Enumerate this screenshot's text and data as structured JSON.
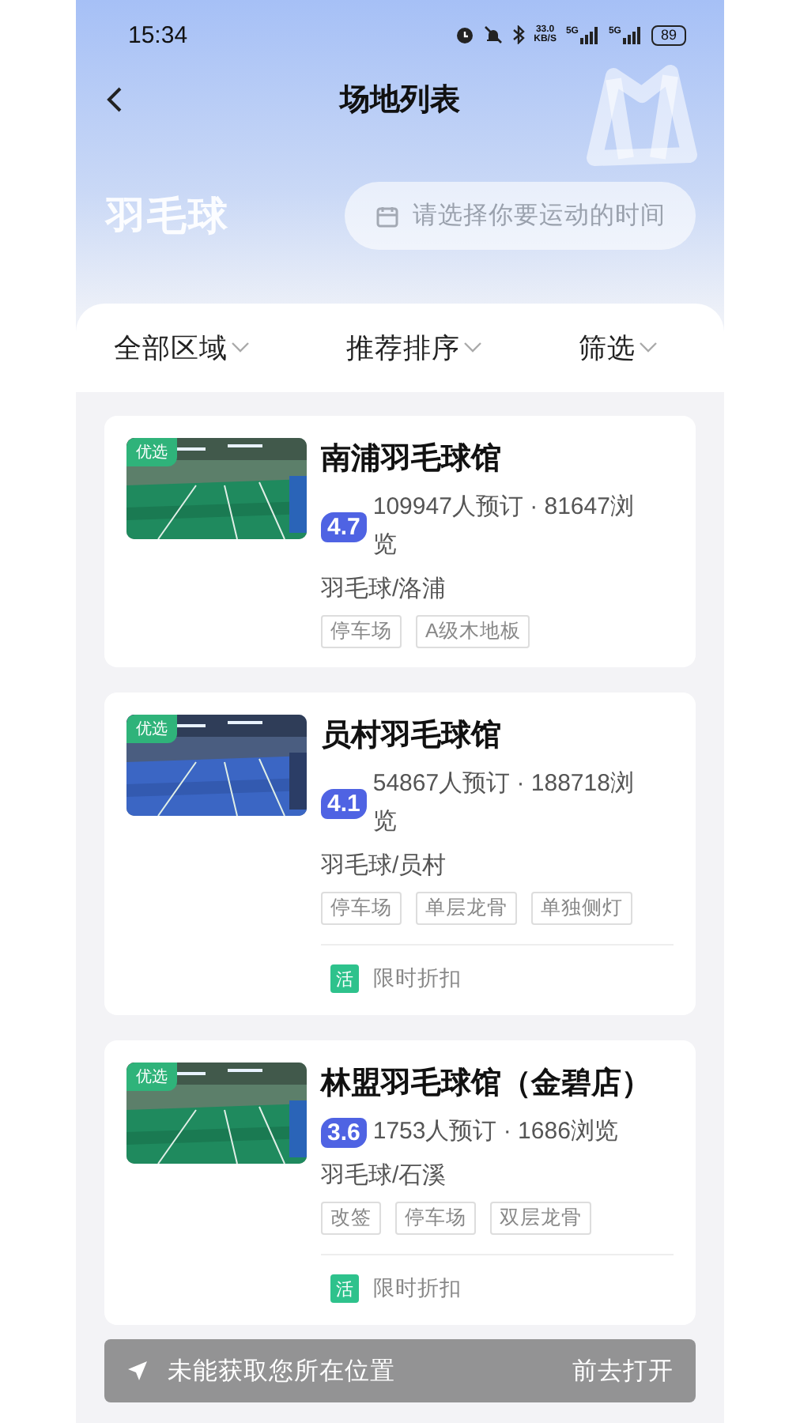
{
  "status_bar": {
    "time": "15:34",
    "speed": "33.0",
    "speed_unit": "KB/S",
    "networks": [
      "5G",
      "5G"
    ],
    "battery": "89"
  },
  "nav": {
    "title": "场地列表"
  },
  "hero": {
    "sport": "羽毛球",
    "date_field": {
      "placeholder": "请选择你要运动的时间"
    }
  },
  "filters": [
    {
      "label": "全部区域"
    },
    {
      "label": "推荐排序"
    },
    {
      "label": "筛选"
    }
  ],
  "venues": [
    {
      "badge": "优选",
      "image": {
        "kind": "picture"
      },
      "name": "南浦羽毛球馆",
      "rating": "4.7",
      "stats": "109947人预订 · 81647浏览",
      "category": "羽毛球/洛浦",
      "tags": [
        "停车场",
        "A级木地板"
      ]
    },
    {
      "badge": "优选",
      "image": {
        "kind": "picture"
      },
      "name": "员村羽毛球馆",
      "rating": "4.1",
      "stats": "54867人预订 · 188718浏览",
      "category": "羽毛球/员村",
      "tags": [
        "停车场",
        "单层龙骨",
        "单独侧灯"
      ],
      "promotions": [
        {
          "tag": "活",
          "text": "限时折扣"
        }
      ]
    },
    {
      "badge": "优选",
      "image": {
        "kind": "picture"
      },
      "name": "林盟羽毛球馆（金碧店）",
      "rating": "3.6",
      "stats": "1753人预订 · 1686浏览",
      "category": "羽毛球/石溪",
      "tags": [
        "改签",
        "停车场",
        "双层龙骨"
      ],
      "promotions": [
        {
          "tag": "活",
          "text": "限时折扣"
        }
      ]
    }
  ],
  "toast": {
    "message": "未能获取您所在位置",
    "action": "前去打开"
  }
}
